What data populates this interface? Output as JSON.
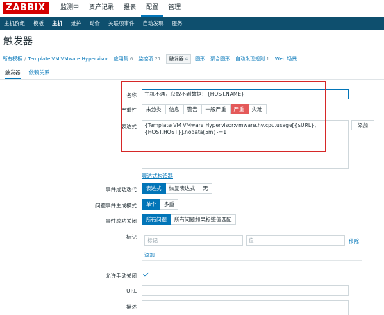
{
  "app": {
    "logo": "ZABBIX",
    "top_menu": [
      "监测中",
      "资产记录",
      "报表",
      "配置",
      "管理"
    ],
    "top_menu_selected": "配置",
    "sub_menu": [
      "主机群组",
      "模板",
      "主机",
      "维护",
      "动作",
      "关联项事件",
      "自动发现",
      "服务"
    ],
    "sub_menu_selected": "主机"
  },
  "page": {
    "title": "触发器"
  },
  "breadcrumb": {
    "all_templates": "所有模板",
    "template": "Template VM VMware Hypervisor",
    "applications": "应用集",
    "applications_count": "6",
    "items": "监控项",
    "items_count": "21",
    "triggers": "触发器",
    "triggers_count": "4",
    "graphs": "图形",
    "screens": "聚合图形",
    "discovery": "自动发现规则",
    "discovery_count": "1",
    "web": "Web 场景"
  },
  "tabs": [
    "触发器",
    "依赖关系"
  ],
  "form": {
    "name_label": "名称",
    "name_value": "主机不通，获取不到数据：{HOST.NAME}",
    "severity_label": "严重性",
    "severity_options": [
      "未分类",
      "信息",
      "警告",
      "一般严重",
      "严重",
      "灾难"
    ],
    "severity_selected": "严重",
    "expression_label": "表达式",
    "expression_line1": "{Template VM VMware Hypervisor:vmware.hv.cpu.usage[{$URL},",
    "expression_line2": "{HOST.HOST}].nodata(5m)}=1",
    "add_button": "添加",
    "expression_constructor": "表达式构造器",
    "ok_event_gen_label": "事件成功迭代",
    "ok_event_gen_options": [
      "表达式",
      "恢复表达式",
      "无"
    ],
    "ok_event_gen_selected": "表达式",
    "problem_mode_label": "问题事件生成模式",
    "problem_mode_options": [
      "单个",
      "多重"
    ],
    "problem_mode_selected": "单个",
    "ok_close_label": "事件成功关闭",
    "ok_close_options": [
      "所有问题",
      "所有问题如果标签值匹配"
    ],
    "ok_close_selected": "所有问题",
    "tags_label": "标记",
    "tag_placeholder": "标记",
    "value_placeholder": "值",
    "remove_link": "移除",
    "add_link": "添加",
    "manual_close_label": "允许手动关闭",
    "manual_close_checked": true,
    "url_label": "URL",
    "url_value": "",
    "description_label": "描述"
  },
  "colors": {
    "brand": "#d40000",
    "subnav": "#0e4f6e",
    "accent": "#0275b8",
    "severity_high": "#e45959",
    "annotation": "#d62828"
  }
}
